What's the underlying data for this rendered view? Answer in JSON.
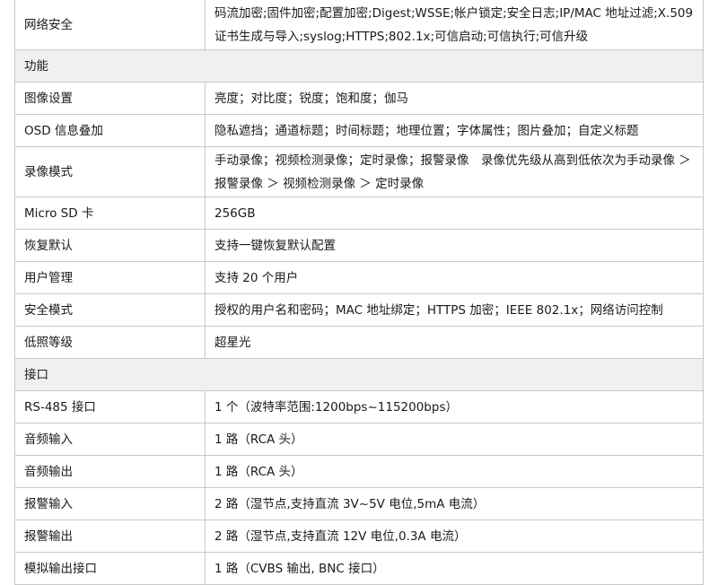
{
  "rows": [
    {
      "type": "row",
      "label": "网络安全",
      "value": "码流加密;固件加密;配置加密;Digest;WSSE;帐户锁定;安全日志;IP/MAC 地址过滤;X.509 证书生成与导入;syslog;HTTPS;802.1x;可信启动;可信执行;可信升级"
    },
    {
      "type": "section",
      "label": "功能"
    },
    {
      "type": "row",
      "label": "图像设置",
      "value": "亮度；对比度；锐度；饱和度；伽马"
    },
    {
      "type": "row",
      "label": "OSD 信息叠加",
      "value": "隐私遮挡；通道标题；时间标题；地理位置；字体属性；图片叠加；自定义标题"
    },
    {
      "type": "row",
      "label": "录像模式",
      "value": "手动录像；视频检测录像；定时录像；报警录像　录像优先级从高到低依次为手动录像 ＞ 报警录像 ＞ 视频检测录像 ＞ 定时录像"
    },
    {
      "type": "row",
      "label": "Micro SD 卡",
      "value": "256GB"
    },
    {
      "type": "row",
      "label": "恢复默认",
      "value": "支持一键恢复默认配置"
    },
    {
      "type": "row",
      "label": "用户管理",
      "value": "支持 20 个用户"
    },
    {
      "type": "row",
      "label": "安全模式",
      "value": "授权的用户名和密码；MAC 地址绑定；HTTPS 加密；IEEE 802.1x；网络访问控制"
    },
    {
      "type": "row",
      "label": "低照等级",
      "value": "超星光"
    },
    {
      "type": "section",
      "label": "接口"
    },
    {
      "type": "row",
      "label": "RS-485 接口",
      "value": "1 个（波特率范围:1200bps~115200bps）"
    },
    {
      "type": "row",
      "label": "音频输入",
      "value": "1 路（RCA 头）"
    },
    {
      "type": "row",
      "label": "音频输出",
      "value": "1 路（RCA 头）"
    },
    {
      "type": "row",
      "label": "报警输入",
      "value": "2 路（湿节点,支持直流 3V~5V 电位,5mA 电流）"
    },
    {
      "type": "row",
      "label": "报警输出",
      "value": "2 路（湿节点,支持直流 12V 电位,0.3A 电流）"
    },
    {
      "type": "row",
      "label": "模拟输出接口",
      "value": "1 路（CVBS 输出, BNC 接口）"
    }
  ]
}
